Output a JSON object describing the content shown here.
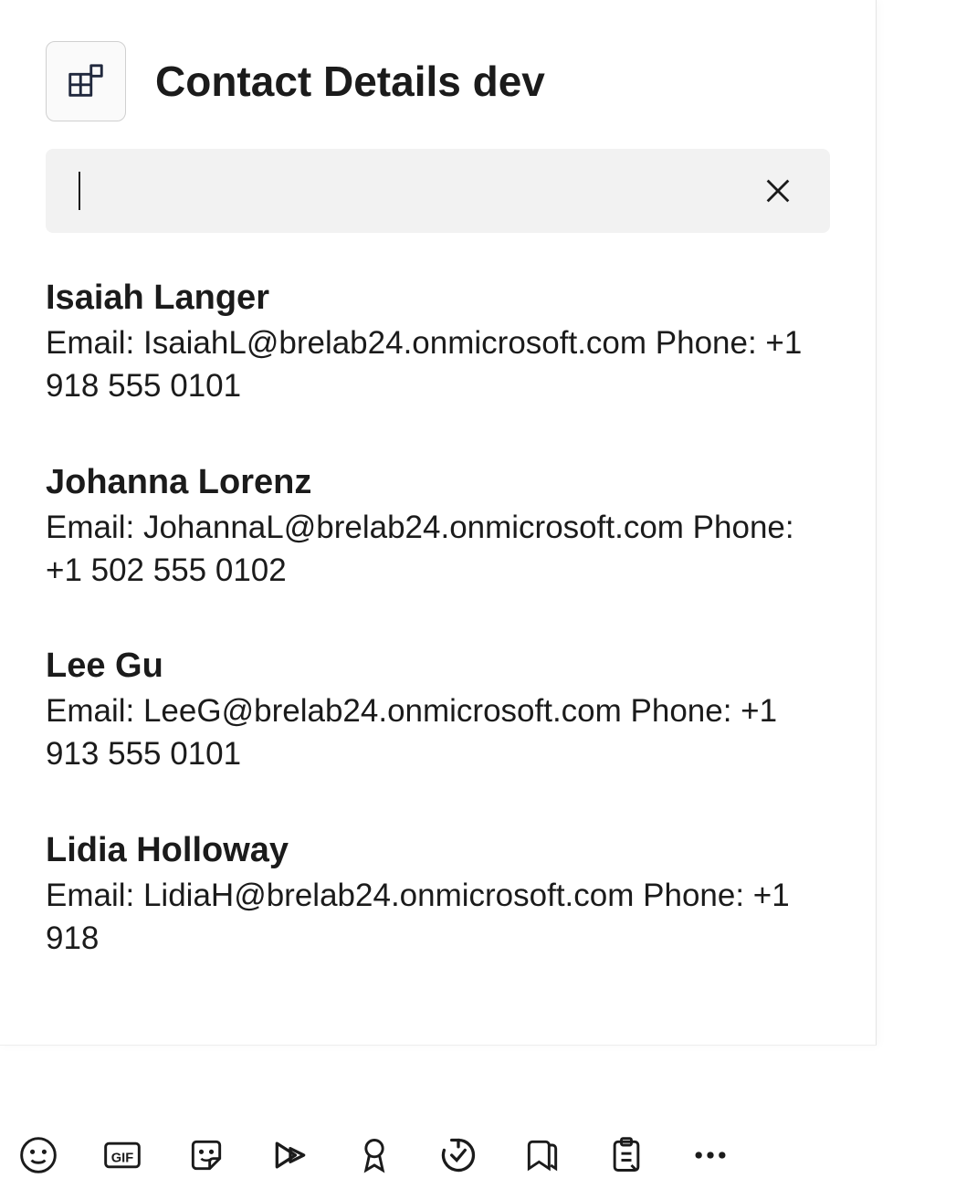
{
  "header": {
    "title": "Contact Details dev"
  },
  "search": {
    "value": "",
    "placeholder": ""
  },
  "contacts": [
    {
      "name": "Isaiah Langer",
      "details": "Email: IsaiahL@brelab24.onmicrosoft.com Phone: +1 918 555 0101"
    },
    {
      "name": "Johanna Lorenz",
      "details": "Email: JohannaL@brelab24.onmicrosoft.com Phone: +1 502 555 0102"
    },
    {
      "name": "Lee Gu",
      "details": "Email: LeeG@brelab24.onmicrosoft.com Phone: +1 913 555 0101"
    },
    {
      "name": "Lidia Holloway",
      "details": "Email: LidiaH@brelab24.onmicrosoft.com Phone: +1 918"
    }
  ],
  "toolbar": {
    "emoji": "Emoji",
    "gif": "GIF",
    "sticker": "Sticker",
    "stream": "Stream",
    "praise": "Praise",
    "approvals": "Approvals",
    "bookmark": "Bookmark",
    "agenda": "Agenda",
    "more": "More"
  }
}
